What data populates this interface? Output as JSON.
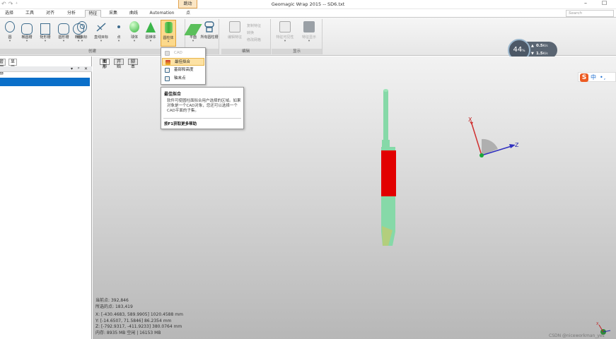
{
  "window": {
    "title": "Geomagic Wrap 2015 -- SD6.txt",
    "context_tab": "跳动",
    "qat_icons": [
      "undo-icon",
      "redo-icon",
      "customize-icon"
    ]
  },
  "tabs": [
    "选择",
    "工具",
    "对齐",
    "分析",
    "特征",
    "采集",
    "曲线",
    "Automation",
    "点"
  ],
  "active_tab": "特征",
  "search_placeholder": "Search",
  "ribbon": {
    "group_create": {
      "label": "创建",
      "buttons": [
        "圆",
        "椭圆槽",
        "矩形槽",
        "圆形槽",
        "椭圆",
        "点目标",
        "直线目标",
        "点",
        "球体",
        "圆锥体",
        "圆柱体",
        "平面",
        "所有圆柱槽"
      ]
    },
    "group_edit": {
      "label": "编辑",
      "buttons": [
        "编辑特征",
        "复制特征",
        "转换",
        "修改网格"
      ]
    },
    "group_display": {
      "label": "显示",
      "buttons": [
        "特征可见性",
        "特征显示"
      ]
    }
  },
  "gauge": {
    "percent": "44",
    "percent_unit": "%",
    "up_value": "0.5",
    "up_unit": "K/s",
    "down_value": "1.5",
    "down_unit": "K/s"
  },
  "left_panel": {
    "tabs": [
      "管理器",
      "显示"
    ],
    "header_symbols": [
      "▾",
      "ᵖ",
      "✕"
    ]
  },
  "viewport_tabs": [
    "图形",
    "开始",
    "脚本"
  ],
  "dropdown": {
    "items": [
      {
        "label": "CAD",
        "enabled": false
      },
      {
        "label": "最佳拟合",
        "enabled": true,
        "highlighted": true
      },
      {
        "label": "基部和高度",
        "enabled": true
      },
      {
        "label": "轴末点",
        "enabled": true
      }
    ]
  },
  "tooltip": {
    "title": "最佳拟合",
    "body": "软件可使圆柱面拟合用户选择的区域。如果对象是一个CAD对象，您还可以选择一个CAD平面的子集。",
    "help": "按F1获取更多帮助"
  },
  "stats": {
    "points_label": "当前点:",
    "points_value": "392,846",
    "selected_label": "所选的点:",
    "selected_value": "183,419",
    "x_line": "X: [-430.4683, 589.9905] 1020.4588 mm",
    "y_line": "Y: [-14.6507, 71.5846] 86.2354 mm",
    "z_line": "Z: [-792.9317, -411.9233] 380.0764 mm",
    "memory": "内存: 8935 MB 空闲 | 16153 MB"
  },
  "ime": {
    "label": "中",
    "extra": "•,"
  },
  "axes": {
    "x": "X",
    "z": "Z"
  },
  "watermark": "CSDN @niceworkman_yes",
  "colors": {
    "accent": "#0a6fc9",
    "cad_green": "#7fd6a3",
    "selection_red": "#e30000"
  }
}
